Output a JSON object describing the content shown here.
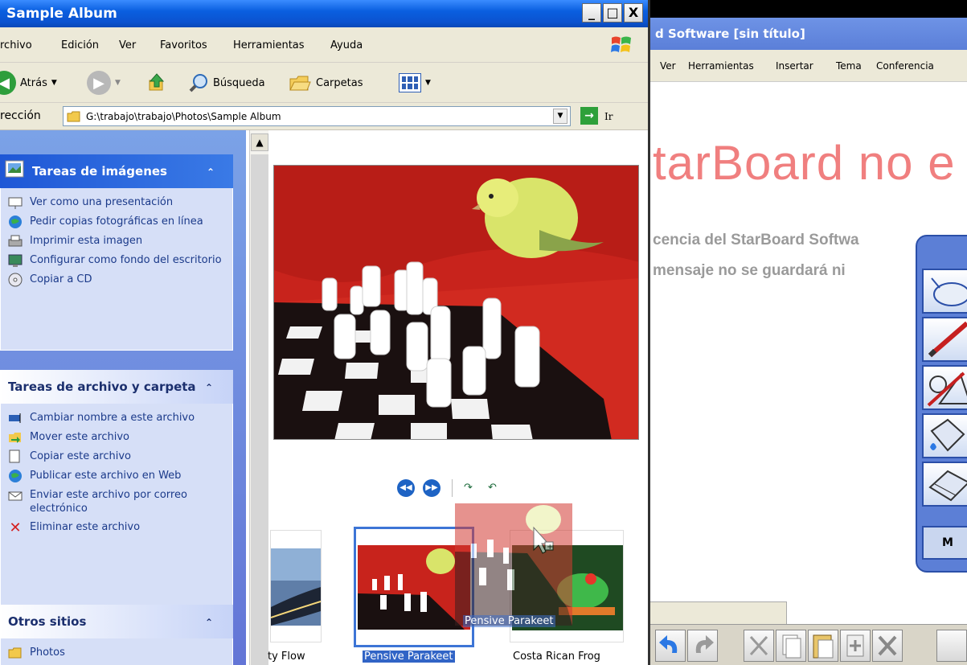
{
  "explorer": {
    "title": "Sample Album",
    "controls": {
      "minimize": "_",
      "maximize": "□",
      "close": "X"
    },
    "menu": [
      "rchivo",
      "Edición",
      "Ver",
      "Favoritos",
      "Herramientas",
      "Ayuda"
    ],
    "toolbar": {
      "back": "Atrás",
      "search": "Búsqueda",
      "folders": "Carpetas"
    },
    "address": {
      "label": "rección",
      "path": "G:\\trabajo\\trabajo\\Photos\\Sample Album",
      "go": "Ir"
    }
  },
  "taskpane": {
    "image_tasks": {
      "title": "Tareas de imágenes",
      "items": [
        "Ver como una presentación",
        "Pedir copias fotográficas en línea",
        "Imprimir esta imagen",
        "Configurar como fondo del escritorio",
        "Copiar a CD"
      ]
    },
    "file_tasks": {
      "title": "Tareas de archivo y carpeta",
      "items": [
        "Cambiar nombre a este archivo",
        "Mover este archivo",
        "Copiar este archivo",
        "Publicar este archivo en Web",
        "Enviar este archivo por correo electrónico",
        "Eliminar este archivo"
      ]
    },
    "other_places": {
      "title": "Otros sitios",
      "items": [
        "Photos"
      ]
    }
  },
  "thumbnails": [
    {
      "caption": "ty Flow"
    },
    {
      "caption": "Pensive Parakeet"
    },
    {
      "caption": "Costa Rican Frog"
    }
  ],
  "drag": {
    "label": "Pensive Parakeet"
  },
  "starboard": {
    "title": "d Software [sin título]",
    "menu": [
      "Ver",
      "Herramientas",
      "Insertar",
      "Tema",
      "Conferencia"
    ],
    "banner": "tarBoard no e",
    "message_lines": [
      "cencia del StarBoard Softwa",
      "mensaje no se guardará ni"
    ],
    "palette_button": "M"
  },
  "colors": {
    "xp_title_blue": "#0a5fe0",
    "selection_blue": "#3164c6",
    "banner_red": "#f07f7f",
    "taskpane_blue": "#6375d6"
  }
}
